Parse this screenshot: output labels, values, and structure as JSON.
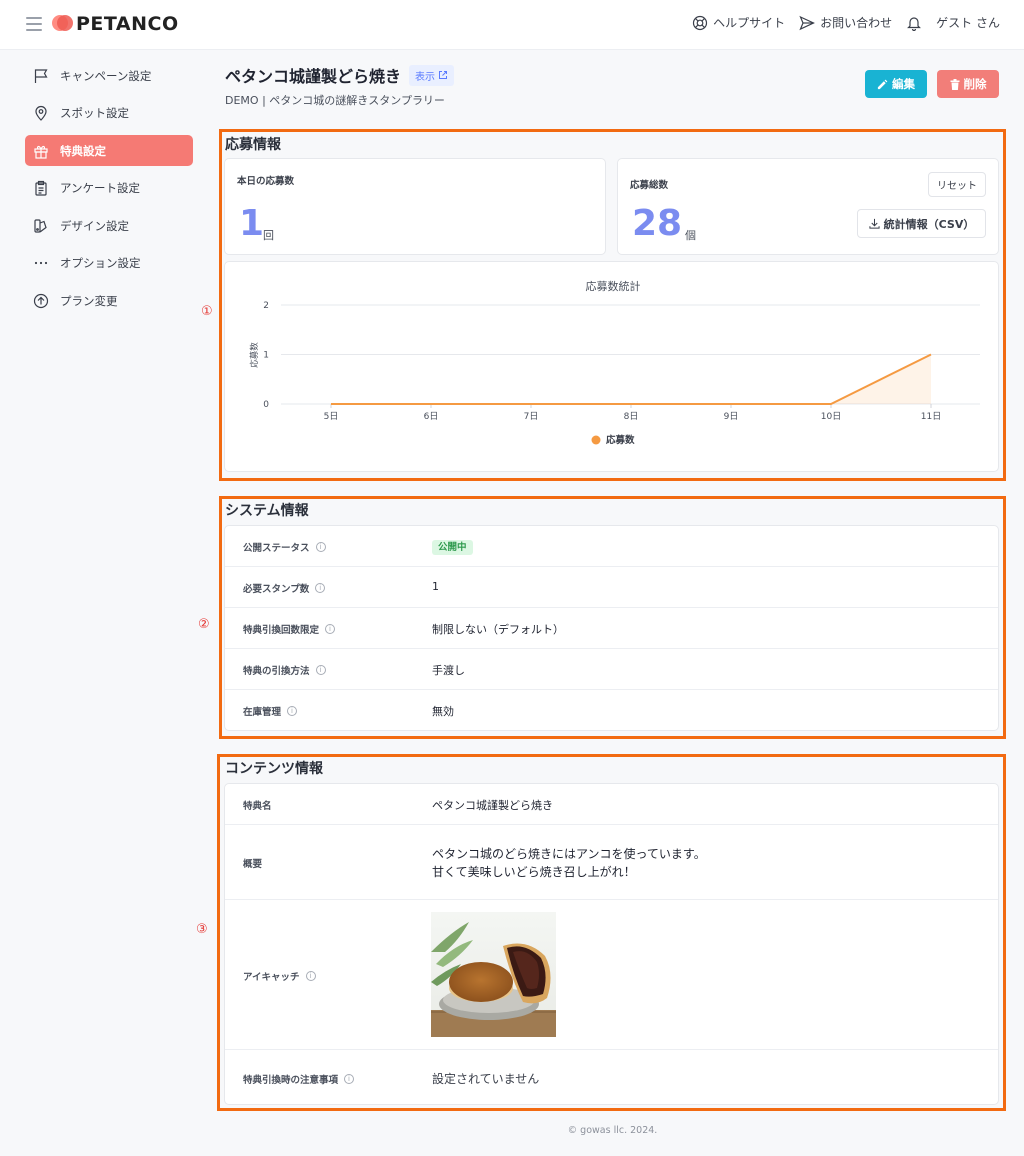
{
  "header": {
    "brand": "PETANCO",
    "help_label": "ヘルプサイト",
    "contact_label": "お問い合わせ",
    "user_label": "ゲスト さん"
  },
  "sidebar": {
    "items": [
      {
        "label": "キャンペーン設定",
        "icon": "flag-icon"
      },
      {
        "label": "スポット設定",
        "icon": "map-pin-icon"
      },
      {
        "label": "特典設定",
        "icon": "gift-icon",
        "active": true
      },
      {
        "label": "アンケート設定",
        "icon": "clipboard-icon"
      },
      {
        "label": "デザイン設定",
        "icon": "palette-icon"
      },
      {
        "label": "オプション設定",
        "icon": "more-dots-icon"
      },
      {
        "label": "プラン変更",
        "icon": "arrow-up-circle-icon"
      }
    ]
  },
  "page": {
    "title": "ペタンコ城謹製どら焼き",
    "view_label": "表示",
    "breadcrumb": "DEMO | ペタンコ城の謎解きスタンプラリー",
    "edit_label": "編集",
    "delete_label": "削除"
  },
  "annotations": {
    "one": "①",
    "two": "②",
    "three": "③"
  },
  "entry": {
    "section_title": "応募情報",
    "today_label": "本日の応募数",
    "today_value": "1",
    "today_unit": "回",
    "total_label": "応募総数",
    "total_value": "28",
    "total_unit": "個",
    "reset_label": "リセット",
    "csv_label": "統計情報（CSV）"
  },
  "chart_data": {
    "type": "area",
    "title": "応募数統計",
    "ylabel": "応募数",
    "xlabel": "",
    "categories": [
      "5日",
      "6日",
      "7日",
      "8日",
      "9日",
      "10日",
      "11日"
    ],
    "series": [
      {
        "name": "応募数",
        "values": [
          0,
          0,
          0,
          0,
          0,
          0,
          1
        ],
        "color": "#f59a42"
      }
    ],
    "ylim": [
      0,
      2
    ],
    "yticks": [
      "0",
      "1",
      "2"
    ],
    "grid": true,
    "legend": "bottom-center"
  },
  "system": {
    "section_title": "システム情報",
    "rows": [
      {
        "label": "公開ステータス",
        "value": "公開中",
        "badge": true
      },
      {
        "label": "必要スタンプ数",
        "value": "1"
      },
      {
        "label": "特典引換回数限定",
        "value": "制限しない（デフォルト）"
      },
      {
        "label": "特典の引換方法",
        "value": "手渡し"
      },
      {
        "label": "在庫管理",
        "value": "無効"
      }
    ]
  },
  "content": {
    "section_title": "コンテンツ情報",
    "name_label": "特典名",
    "name_value": "ペタンコ城謹製どら焼き",
    "summary_label": "概要",
    "summary_line1": "ペタンコ城のどら焼きにはアンコを使っています。",
    "summary_line2": "甘くて美味しいどら焼き召し上がれ！",
    "eyecatch_label": "アイキャッチ",
    "notes_label": "特典引換時の注意事項",
    "notes_value": "設定されていません"
  },
  "footer": {
    "text": "© gowas llc. 2024."
  },
  "colors": {
    "accent": "#f57a74",
    "edit": "#19b3d3",
    "delete": "#f27e79",
    "annotation": "#f26a11",
    "chart_line": "#f59a42",
    "big_number": "#7b8cf0"
  }
}
